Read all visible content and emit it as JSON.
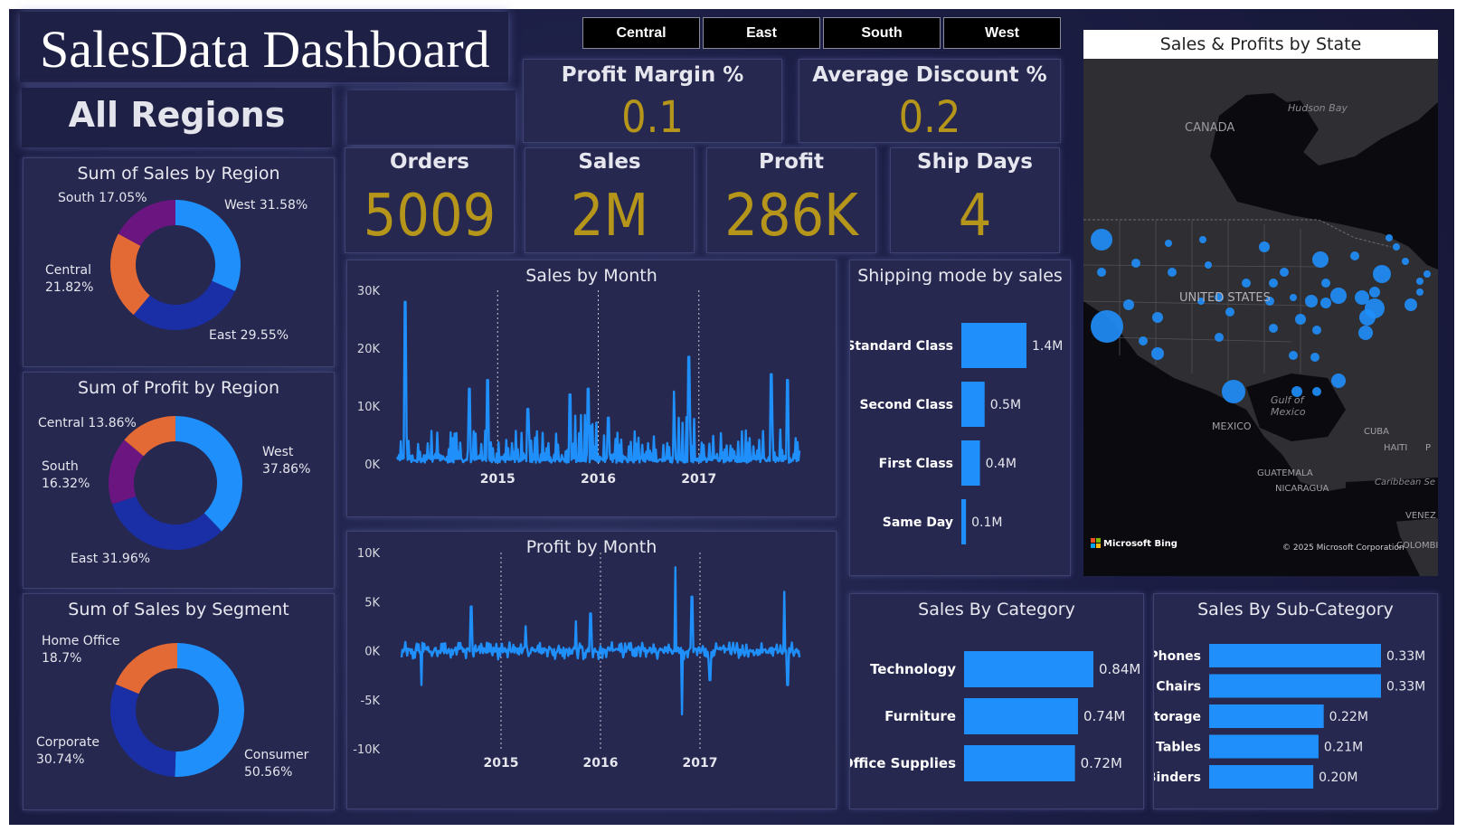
{
  "header": {
    "title": "SalesData Dashboard",
    "region_title": "All Regions",
    "tabs": [
      "Central",
      "East",
      "South",
      "West"
    ]
  },
  "kpis": {
    "profit_margin": {
      "label": "Profit Margin %",
      "value": "0.1"
    },
    "avg_discount": {
      "label": "Average Discount %",
      "value": "0.2"
    },
    "orders": {
      "label": "Orders",
      "value": "5009"
    },
    "sales": {
      "label": "Sales",
      "value": "2M"
    },
    "profit": {
      "label": "Profit",
      "value": "286K"
    },
    "ship_days": {
      "label": "Ship Days",
      "value": "4"
    }
  },
  "colors": {
    "blue": "#1f8ffb",
    "navy": "#1a2fa5",
    "orange": "#e36a35",
    "purple": "#6a1580",
    "gold": "#b5961a"
  },
  "map": {
    "title": "Sales & Profits by State",
    "labels": [
      "CANADA",
      "Hudson Bay",
      "UNITED STATES",
      "Gulf of",
      "Mexico",
      "MEXICO",
      "CUBA",
      "HAITI",
      "P",
      "GUATEMALA",
      "NICARAGUA",
      "Caribbean Se",
      "VENEZ",
      "COLOMBIA"
    ],
    "brand": "Microsoft Bing",
    "copyright": "© 2025 Microsoft Corporation"
  },
  "chart_data": [
    {
      "type": "pie",
      "title": "Sum of Sales by Region",
      "slices": [
        {
          "label": "West",
          "pct_label": "31.58%",
          "value": 31.58,
          "color": "#1f8ffb"
        },
        {
          "label": "East",
          "pct_label": "29.55%",
          "value": 29.55,
          "color": "#1a2fa5"
        },
        {
          "label": "Central",
          "pct_label": "21.82%",
          "value": 21.82,
          "color": "#e36a35"
        },
        {
          "label": "South",
          "pct_label": "17.05%",
          "value": 17.05,
          "color": "#6a1580"
        }
      ]
    },
    {
      "type": "pie",
      "title": "Sum of Profit by Region",
      "slices": [
        {
          "label": "West",
          "pct_label": "37.86%",
          "value": 37.86,
          "color": "#1f8ffb"
        },
        {
          "label": "East",
          "pct_label": "31.96%",
          "value": 31.96,
          "color": "#1a2fa5"
        },
        {
          "label": "South",
          "pct_label": "16.32%",
          "value": 16.32,
          "color": "#6a1580"
        },
        {
          "label": "Central",
          "pct_label": "13.86%",
          "value": 13.86,
          "color": "#e36a35"
        }
      ]
    },
    {
      "type": "pie",
      "title": "Sum of Sales by Segment",
      "slices": [
        {
          "label": "Consumer",
          "pct_label": "50.56%",
          "value": 50.56,
          "color": "#1f8ffb"
        },
        {
          "label": "Corporate",
          "pct_label": "30.74%",
          "value": 30.74,
          "color": "#1a2fa5"
        },
        {
          "label": "Home Office",
          "pct_label": "18.7%",
          "value": 18.7,
          "color": "#e36a35"
        }
      ]
    },
    {
      "type": "line",
      "title": "Sales by Month",
      "x_ticks": [
        "2015",
        "2016",
        "2017"
      ],
      "y_ticks": [
        "30K",
        "20K",
        "10K",
        "0K"
      ],
      "ylim": [
        0,
        30000
      ],
      "peaks": [
        {
          "x": 2014.08,
          "y": 28000
        },
        {
          "x": 2014.72,
          "y": 13000
        },
        {
          "x": 2014.9,
          "y": 14500
        },
        {
          "x": 2015.3,
          "y": 9500
        },
        {
          "x": 2015.72,
          "y": 12000
        },
        {
          "x": 2015.9,
          "y": 13000
        },
        {
          "x": 2016.1,
          "y": 8000
        },
        {
          "x": 2016.75,
          "y": 12500
        },
        {
          "x": 2016.9,
          "y": 18500
        },
        {
          "x": 2017.72,
          "y": 15500
        },
        {
          "x": 2017.88,
          "y": 14500
        }
      ]
    },
    {
      "type": "line",
      "title": "Profit by Month",
      "x_ticks": [
        "2015",
        "2016",
        "2017"
      ],
      "y_ticks": [
        "10K",
        "5K",
        "0K",
        "-5K",
        "-10K"
      ],
      "ylim": [
        -10000,
        10000
      ],
      "peaks": [
        {
          "x": 2014.2,
          "y": -3500
        },
        {
          "x": 2014.7,
          "y": 4500
        },
        {
          "x": 2015.25,
          "y": 2500
        },
        {
          "x": 2015.75,
          "y": 3000
        },
        {
          "x": 2015.9,
          "y": 3800
        },
        {
          "x": 2016.75,
          "y": 8500
        },
        {
          "x": 2016.82,
          "y": -6500
        },
        {
          "x": 2016.92,
          "y": 5500
        },
        {
          "x": 2017.1,
          "y": -3000
        },
        {
          "x": 2017.85,
          "y": 6000
        },
        {
          "x": 2017.88,
          "y": -3500
        }
      ]
    },
    {
      "type": "bar",
      "title": "Shipping mode by sales",
      "categories": [
        "Standard Class",
        "Second Class",
        "First Class",
        "Same Day"
      ],
      "values": [
        1.4,
        0.5,
        0.4,
        0.1
      ],
      "value_labels": [
        "1.4M",
        "0.5M",
        "0.4M",
        "0.1M"
      ]
    },
    {
      "type": "bar",
      "title": "Sales By Category",
      "categories": [
        "Technology",
        "Furniture",
        "Office Supplies"
      ],
      "values": [
        0.84,
        0.74,
        0.72
      ],
      "value_labels": [
        "0.84M",
        "0.74M",
        "0.72M"
      ]
    },
    {
      "type": "bar",
      "title": "Sales By Sub-Category",
      "categories": [
        "Phones",
        "Chairs",
        "Storage",
        "Tables",
        "Binders"
      ],
      "values": [
        0.33,
        0.33,
        0.22,
        0.21,
        0.2
      ],
      "value_labels": [
        "0.33M",
        "0.33M",
        "0.22M",
        "0.21M",
        "0.20M"
      ]
    }
  ]
}
